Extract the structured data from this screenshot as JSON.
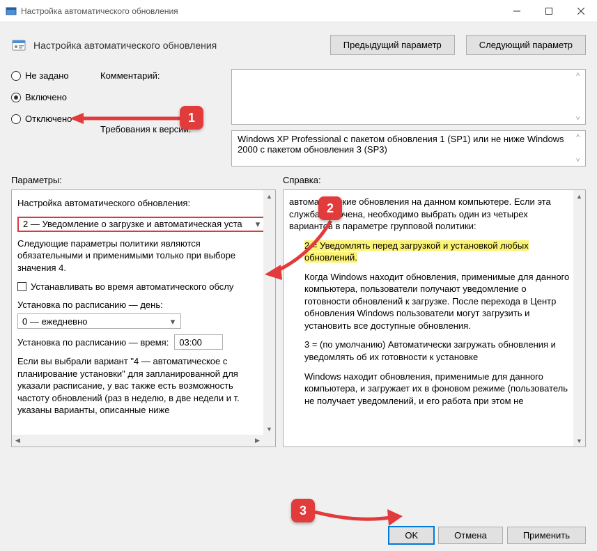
{
  "window": {
    "title": "Настройка автоматического обновления"
  },
  "header": {
    "policy_title": "Настройка автоматического обновления",
    "prev": "Предыдущий параметр",
    "next": "Следующий параметр"
  },
  "state": {
    "not_configured": "Не задано",
    "enabled": "Включено",
    "disabled": "Отключено",
    "selected": "enabled"
  },
  "labels": {
    "comment": "Комментарий:",
    "supported": "Требования к версии:",
    "options": "Параметры:",
    "help": "Справка:"
  },
  "supported_text": "Windows XP Professional с пакетом обновления 1 (SP1) или не ниже Windows 2000 с пакетом обновления 3 (SP3)",
  "options": {
    "title": "Настройка автоматического обновления:",
    "mode_value": "2 — Уведомление о загрузке и автоматическая уста",
    "note": "Следующие параметры политики являются обязательными и применимыми только при выборе значения 4.",
    "maint_checkbox": "Устанавливать во время автоматического обслу",
    "sched_day_label": "Установка по расписанию — день:",
    "sched_day_value": "0 — ежедневно",
    "sched_time_label": "Установка по расписанию — время:",
    "sched_time_value": "03:00",
    "tail": "Если вы выбрали вариант \"4 — автоматическое с планирование установки\" для запланированной для указали расписание, у вас также есть возможность частоту обновлений (раз в неделю, в две недели и т. указаны варианты, описанные ниже"
  },
  "help": {
    "p1": "автоматические обновления на данном компьютере. Если эта служба включена, необходимо выбрать один из четырех вариантов в параметре групповой политики:",
    "p2": "2 = Уведомлять перед загрузкой и установкой любых обновлений.",
    "p3": "Когда Windows находит обновления, применимые для данного компьютера, пользователи получают уведомление о готовности обновлений к загрузке. После перехода в Центр обновления Windows пользователи могут загрузить и установить все доступные обновления.",
    "p4": "3 = (по умолчанию) Автоматически загружать обновления и уведомлять об их готовности к установке",
    "p5": "Windows находит обновления, применимые для данного компьютера, и загружает их в фоновом режиме (пользователь не получает уведомлений, и его работа при этом не"
  },
  "buttons": {
    "ok": "OK",
    "cancel": "Отмена",
    "apply": "Применить"
  },
  "annotations": {
    "c1": "1",
    "c2": "2",
    "c3": "3"
  }
}
